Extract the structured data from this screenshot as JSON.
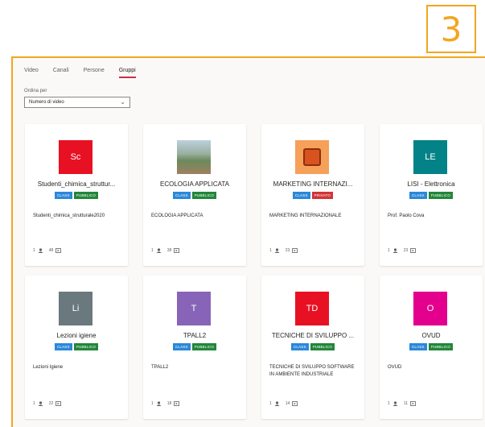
{
  "callout": {
    "number": "3"
  },
  "tabs": [
    {
      "label": "Video",
      "active": false
    },
    {
      "label": "Canali",
      "active": false
    },
    {
      "label": "Persone",
      "active": false
    },
    {
      "label": "Gruppi",
      "active": true
    }
  ],
  "sort": {
    "label": "Ordina per",
    "value": "Numero di video"
  },
  "colors": {
    "accent_orange": "#f2a61f",
    "class_badge": "#2b88d8",
    "public_badge": "#22863a",
    "private_badge": "#d13438"
  },
  "groups": [
    {
      "initials": "Sc",
      "color": "#e81123",
      "name": "Studenti_chimica_struttur...",
      "badges": [
        "CLASS",
        "PUBBLICO"
      ],
      "description": "Studenti_chimica_strutturale2020",
      "members": "1",
      "videos": "48"
    },
    {
      "initials": "",
      "color": "",
      "name": "ECOLOGIA APPLICATA",
      "badges": [
        "CLASS",
        "PUBBLICO"
      ],
      "description": "ECOLOGIA APPLICATA",
      "members": "1",
      "videos": "38"
    },
    {
      "initials": "",
      "color": "",
      "name": "MARKETING INTERNAZI...",
      "badges": [
        "CLASS",
        "PRIVATO"
      ],
      "description": "MARKETING INTERNAZIONALE",
      "members": "1",
      "videos": "23"
    },
    {
      "initials": "LE",
      "color": "#038387",
      "name": "LISI - Elettronica",
      "badges": [
        "CLASS",
        "PUBBLICO"
      ],
      "description": "Prof. Paolo Cova",
      "members": "1",
      "videos": "23"
    },
    {
      "initials": "Li",
      "color": "#69797e",
      "name": "Lezioni igiene",
      "badges": [
        "CLASS",
        "PUBBLICO"
      ],
      "description": "Lezioni Igiene",
      "members": "1",
      "videos": "22"
    },
    {
      "initials": "T",
      "color": "#8764b8",
      "name": "TPALL2",
      "badges": [
        "CLASS",
        "PUBBLICO"
      ],
      "description": "TPALL2",
      "members": "1",
      "videos": "18"
    },
    {
      "initials": "TD",
      "color": "#e81123",
      "name": "TECNICHE DI SVILUPPO ...",
      "badges": [
        "CLASS",
        "PUBBLICO"
      ],
      "description": "TECNICHE DI SVILUPPO SOFTWARE IN AMBIENTE INDUSTRIALE",
      "members": "1",
      "videos": "14"
    },
    {
      "initials": "O",
      "color": "#e3008c",
      "name": "OVUD",
      "badges": [
        "CLASS",
        "PUBBLICO"
      ],
      "description": "OVUD",
      "members": "1",
      "videos": "11"
    }
  ]
}
